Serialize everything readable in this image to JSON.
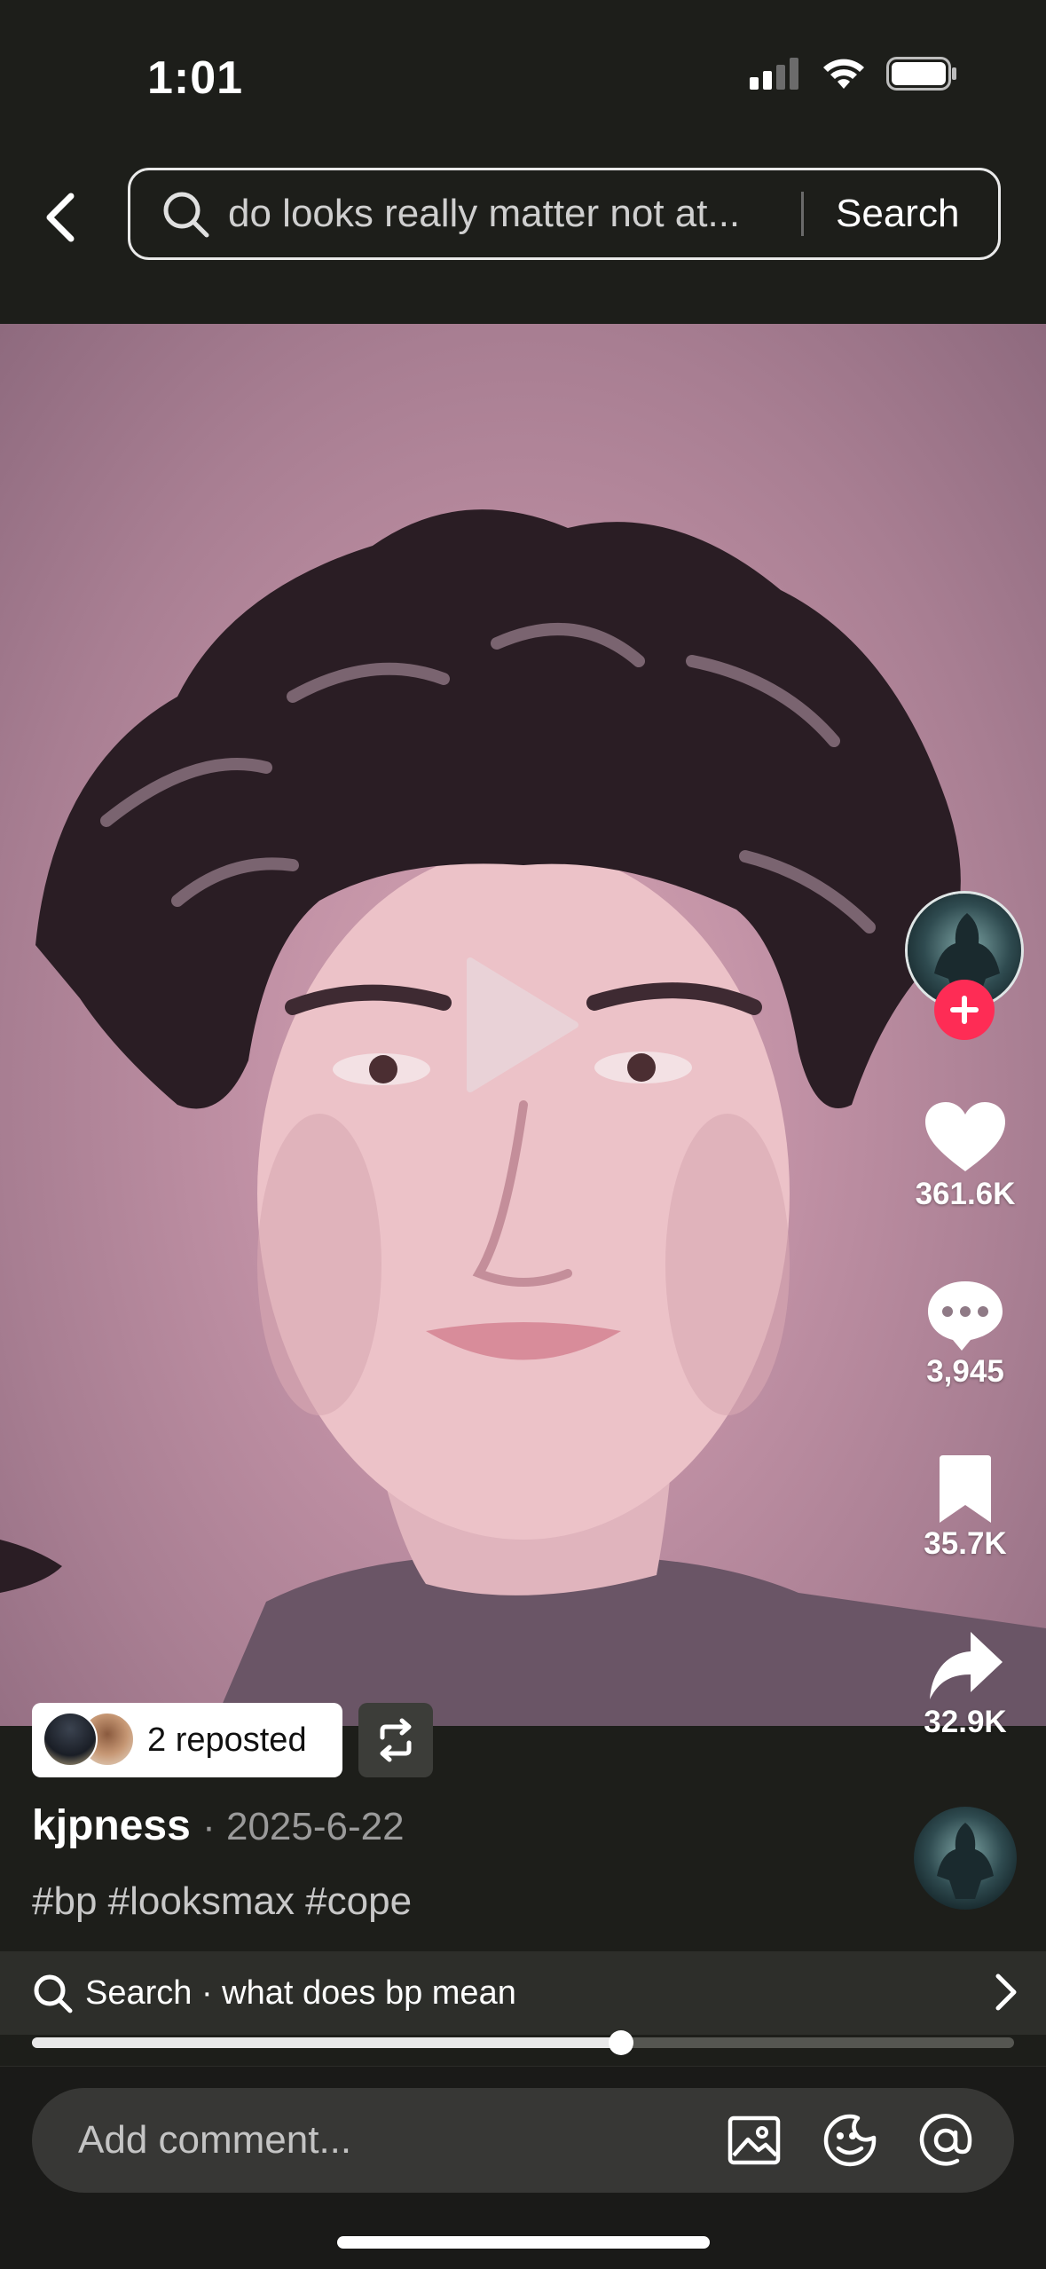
{
  "status_bar": {
    "time": "1:01"
  },
  "search": {
    "query": "do looks really matter not at...",
    "button_label": "Search"
  },
  "video": {
    "state": "paused"
  },
  "actions": {
    "likes": "361.6K",
    "comments": "3,945",
    "saves": "35.7K",
    "shares": "32.9K"
  },
  "repost": {
    "label": "2 reposted"
  },
  "post": {
    "author": "kjpness",
    "date": "· 2025-6-22",
    "hashtags": "#bp #looksmax #cope"
  },
  "suggestion": {
    "text": "Search · what does bp mean"
  },
  "playback": {
    "progress": 0.6
  },
  "comment": {
    "placeholder": "Add comment..."
  },
  "colors": {
    "accent": "#fe2c55",
    "background": "#1d1e1a"
  }
}
